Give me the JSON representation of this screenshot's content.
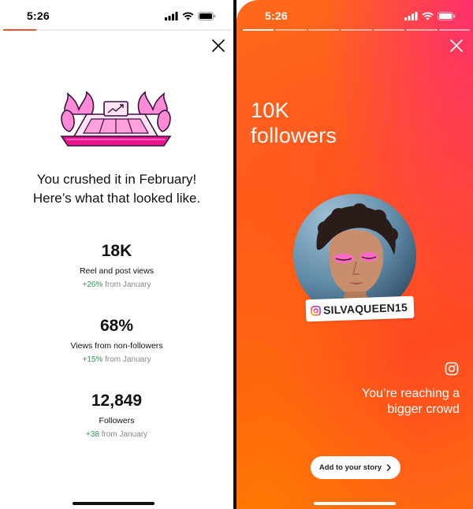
{
  "status_bar": {
    "time": "5:26"
  },
  "recap": {
    "headline_line1": "You crushed it in February!",
    "headline_line2": "Here’s what that looked like.",
    "stats": [
      {
        "value": "18K",
        "label": "Reel and post views",
        "delta": "+26%",
        "period": "from January"
      },
      {
        "value": "68%",
        "label": "Views from non-followers",
        "delta": "+15%",
        "period": "from January"
      },
      {
        "value": "12,849",
        "label": "Followers",
        "delta": "+38",
        "period": "from January"
      }
    ]
  },
  "story": {
    "title_line1": "10K",
    "title_line2": "followers",
    "username": "SILVAQUEEN15",
    "message_line1": "You’re reaching a",
    "message_line2": "bigger crowd",
    "add_button_label": "Add to your story",
    "progress": {
      "segments_total": 7,
      "segments_done": 1
    }
  },
  "colors": {
    "accent_progress": "#ef5533",
    "positive_delta": "#2f9a4b",
    "story_background": "#ff5320"
  },
  "icons": [
    "signal-icon",
    "wifi-icon",
    "battery-icon",
    "close-icon",
    "trophy-illustration",
    "instagram-icon",
    "chevron-right-icon"
  ]
}
